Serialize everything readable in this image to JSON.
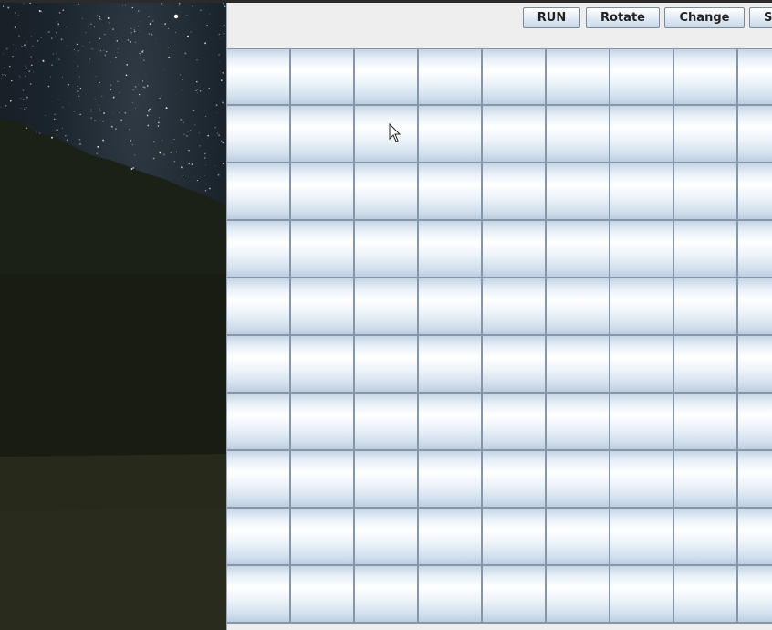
{
  "toolbar": {
    "buttons": [
      {
        "label": "RUN"
      },
      {
        "label": "Rotate"
      },
      {
        "label": "Change"
      },
      {
        "label": "S"
      }
    ]
  },
  "grid": {
    "rows": 10,
    "columns_visible": 9
  },
  "colors": {
    "cell_border": "#8696a8",
    "button_border": "#7a8a99",
    "panel_background": "#eeeeee"
  },
  "cursor": {
    "type": "arrow-pointer-icon"
  }
}
